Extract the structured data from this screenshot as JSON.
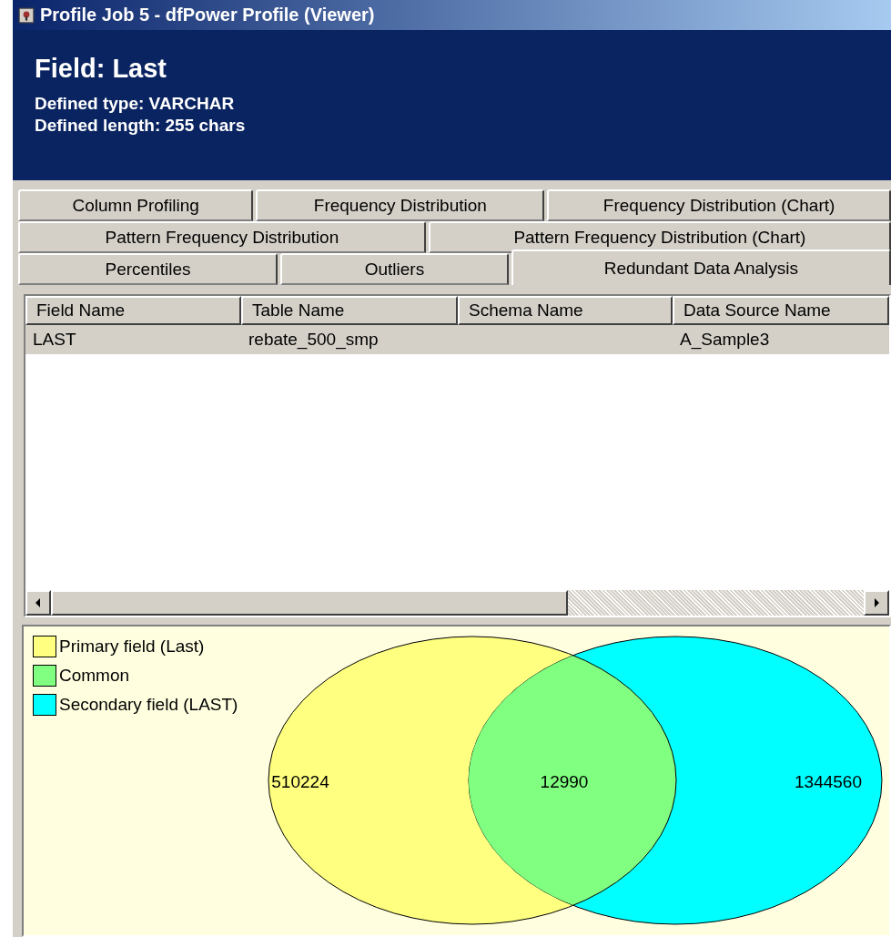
{
  "window": {
    "title": "Profile Job 5 - dfPower Profile (Viewer)"
  },
  "header": {
    "title": "Field: Last",
    "lines": [
      "Defined type: VARCHAR",
      "Defined length: 255 chars"
    ]
  },
  "tab_rows": [
    [
      {
        "label": "Column Profiling",
        "selected": false
      },
      {
        "label": "Frequency Distribution",
        "selected": false
      },
      {
        "label": "Frequency Distribution (Chart)",
        "selected": false
      }
    ],
    [
      {
        "label": "Pattern Frequency Distribution",
        "selected": false
      },
      {
        "label": "Pattern Frequency Distribution (Chart)",
        "selected": false
      }
    ],
    [
      {
        "label": "Percentiles",
        "selected": false
      },
      {
        "label": "Outliers",
        "selected": false
      },
      {
        "label": "Redundant Data Analysis",
        "selected": true
      }
    ]
  ],
  "table": {
    "columns": [
      "Field Name",
      "Table Name",
      "Schema Name",
      "Data Source Name"
    ],
    "rows": [
      {
        "cells": [
          "LAST",
          "rebate_500_smp",
          "",
          "A_Sample3"
        ],
        "selected": true
      }
    ]
  },
  "venn": {
    "legend": [
      {
        "label": "Primary field (Last)",
        "color": "#ffff80"
      },
      {
        "label": "Common",
        "color": "#80ff80"
      },
      {
        "label": "Secondary field (LAST)",
        "color": "#00ffff"
      }
    ],
    "counts": [
      {
        "kind": "primary",
        "value": "510224"
      },
      {
        "kind": "common",
        "value": "12990"
      },
      {
        "kind": "secondary",
        "value": "1344560"
      }
    ]
  }
}
